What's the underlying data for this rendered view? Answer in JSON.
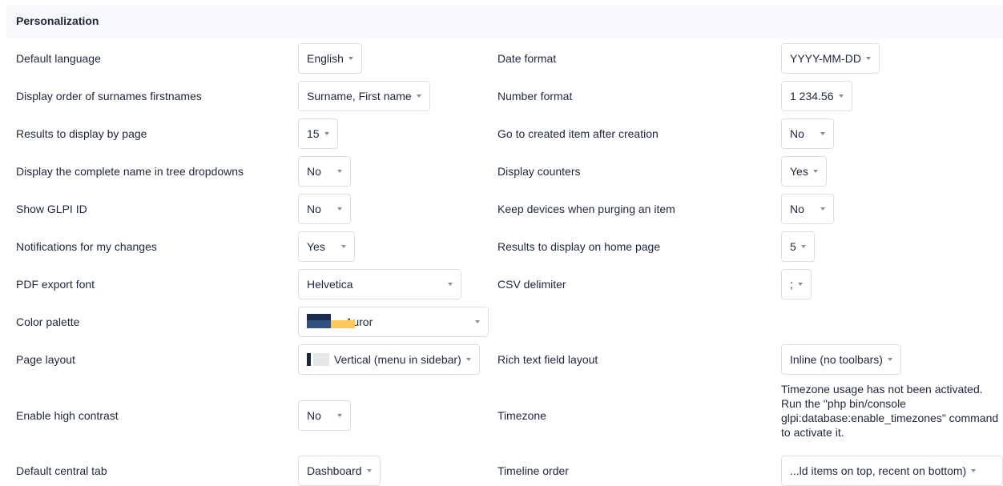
{
  "section": {
    "title": "Personalization"
  },
  "left": {
    "default_language": {
      "label": "Default language",
      "value": "English"
    },
    "display_order": {
      "label": "Display order of surnames firstnames",
      "value": "Surname, First name"
    },
    "results_per_page": {
      "label": "Results to display by page",
      "value": "15"
    },
    "complete_name_tree": {
      "label": "Display the complete name in tree dropdowns",
      "value": "No"
    },
    "show_glpi_id": {
      "label": "Show GLPI ID",
      "value": "No"
    },
    "notifications_changes": {
      "label": "Notifications for my changes",
      "value": "Yes"
    },
    "pdf_font": {
      "label": "PDF export font",
      "value": "Helvetica"
    },
    "color_palette": {
      "label": "Color palette",
      "value": "Auror",
      "swatch_colors": [
        "#1b2a4e",
        "#33517f",
        "#ffc85c"
      ]
    },
    "page_layout": {
      "label": "Page layout",
      "value": "Vertical (menu in sidebar)"
    },
    "high_contrast": {
      "label": "Enable high contrast",
      "value": "No"
    },
    "central_tab": {
      "label": "Default central tab",
      "value": "Dashboard"
    }
  },
  "right": {
    "date_format": {
      "label": "Date format",
      "value": "YYYY-MM-DD"
    },
    "number_format": {
      "label": "Number format",
      "value": "1 234.56"
    },
    "goto_created": {
      "label": "Go to created item after creation",
      "value": "No"
    },
    "display_counters": {
      "label": "Display counters",
      "value": "Yes"
    },
    "keep_devices": {
      "label": "Keep devices when purging an item",
      "value": "No"
    },
    "results_home": {
      "label": "Results to display on home page",
      "value": "5"
    },
    "csv_delimiter": {
      "label": "CSV delimiter",
      "value": ";"
    },
    "rich_text_layout": {
      "label": "Rich text field layout",
      "value": "Inline (no toolbars)"
    },
    "timezone": {
      "label": "Timezone",
      "note": "Timezone usage has not been activated. Run the \"php bin/console glpi:database:enable_timezones\" command to activate it."
    },
    "timeline_order": {
      "label": "Timeline order",
      "value": "...ld items on top, recent on bottom)"
    }
  }
}
